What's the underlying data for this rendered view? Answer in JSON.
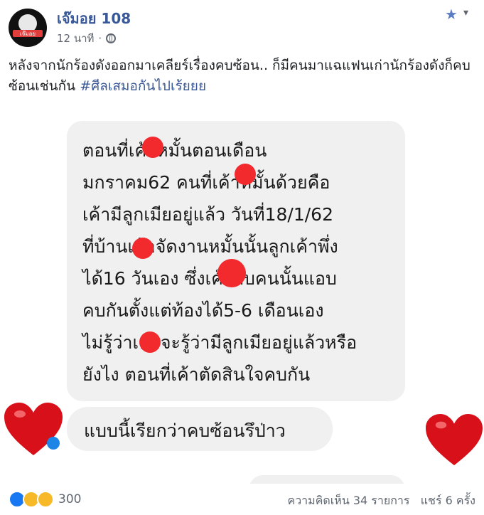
{
  "post": {
    "page_name": "เจ๊มอย 108",
    "avatar_text": "เจ๊มอย",
    "time": "12 นาที",
    "separator": "·",
    "caption_text": "หลังจากนักร้องดังออกมาเคลียร์เรื่องคบซ้อน.. ก็มีคนมาแฉแฟนเก่านักร้องดังก็คบซ้อนเช่นกัน",
    "hashtag": "#ศีลเสมอกันไปเร้ยยย"
  },
  "icons": {
    "star": "star-icon",
    "chevron": "chevron-down-icon",
    "globe": "globe-icon",
    "heart": "heart-icon",
    "messenger": "messenger-icon"
  },
  "photo": {
    "message_lines": [
      "ตอนที่เค้าหมั้นตอนเดือน",
      "มกราคม62 คนที่เค้าหมั้นด้วยคือ",
      "เค้ามีลูกเมียอยู่แล้ว วันที่18/1/62",
      "ที่บ้านเค้าจัดงานหมั้นนั้นลูกเค้าพึ่ง",
      "ได้16 วันเอง ซึ่งเค้ากับคนนั้นแอบ",
      "คบกันตั้งแต่ท้องได้5-6 เดือนเอง",
      "ไม่รู้ว่าเค้าจะรู้ว่ามีลูกเมียอยู่แล้วหรือ",
      "ยังไง ตอนที่เค้าตัดสินใจคบกัน"
    ],
    "reply": "แบบนี้เรียกว่าคบซ้อนรึป่าว"
  },
  "footer": {
    "reaction_count": "300",
    "comments": "ความคิดเห็น 34 รายการ",
    "shares": "แชร์ 6 ครั้ง"
  },
  "colors": {
    "brand_blue": "#385898",
    "bubble": "#f1f0f0",
    "redaction": "#f2292d",
    "heart": "#d8101a"
  }
}
